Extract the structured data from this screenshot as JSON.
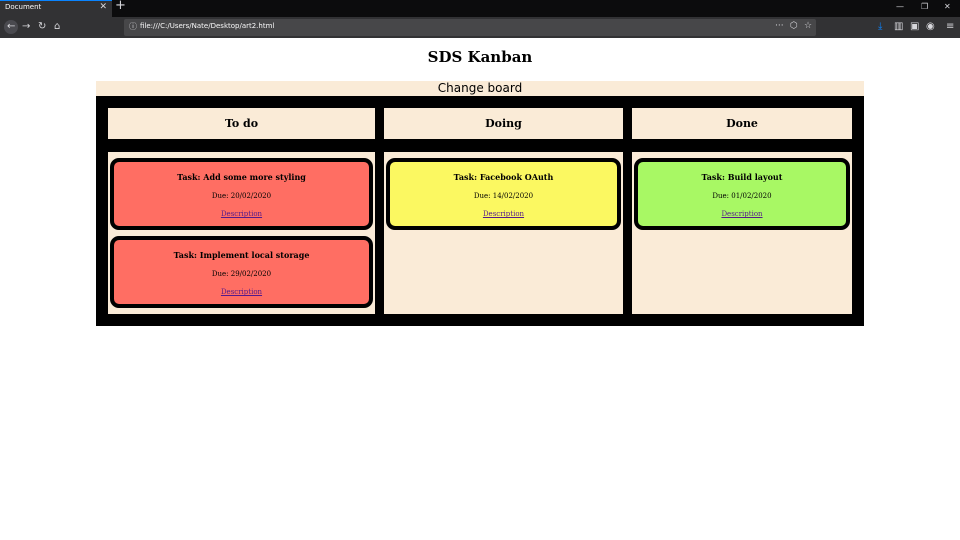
{
  "browser": {
    "tab_title": "Document",
    "url": "file:///C:/Users/Nate/Desktop/art2.html"
  },
  "page": {
    "title": "SDS Kanban",
    "change_board_label": "Change board"
  },
  "columns": [
    {
      "title": "To do",
      "cards": [
        {
          "title": "Task: Add some more styling",
          "due": "Due: 20/02/2020",
          "link": "Description",
          "color": "#ff6e63"
        },
        {
          "title": "Task: Implement local storage",
          "due": "Due: 29/02/2020",
          "link": "Description",
          "color": "#ff6e63"
        }
      ]
    },
    {
      "title": "Doing",
      "cards": [
        {
          "title": "Task: Facebook OAuth",
          "due": "Due: 14/02/2020",
          "link": "Description",
          "color": "#fbf861"
        }
      ]
    },
    {
      "title": "Done",
      "cards": [
        {
          "title": "Task: Build layout",
          "due": "Due: 01/02/2020",
          "link": "Description",
          "color": "#a8f864"
        }
      ]
    }
  ]
}
